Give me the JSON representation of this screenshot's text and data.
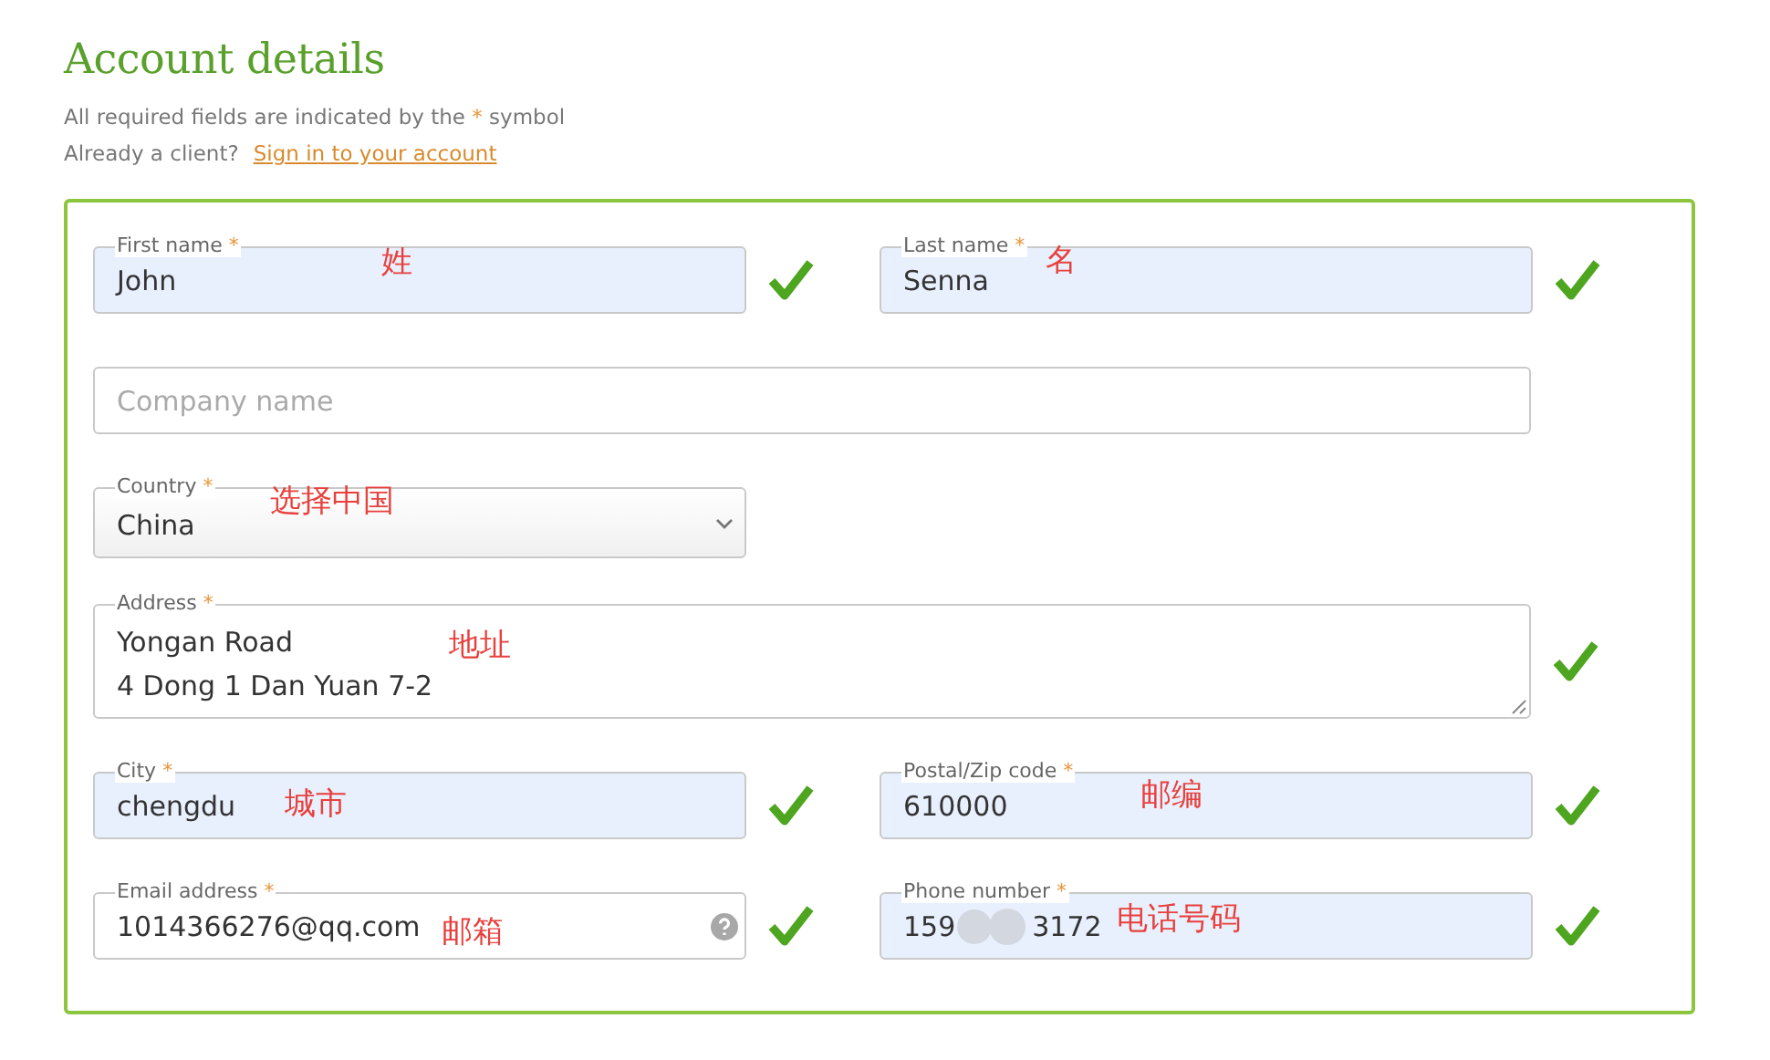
{
  "heading": {
    "title": "Account details",
    "required_note": {
      "before": "All required fields are indicated by the",
      "mark": "*",
      "after": "symbol"
    },
    "signin": {
      "prompt": "Already a client?",
      "link": "Sign in to your account"
    }
  },
  "rows": [
    [
      {
        "kind": "text",
        "label": "First name",
        "required": true,
        "value": "John",
        "autofilled": true,
        "valid": true,
        "annotation": "姓"
      },
      {
        "kind": "text",
        "label": "Last name",
        "required": true,
        "value": "Senna",
        "autofilled": true,
        "valid": true,
        "annotation": "名"
      }
    ],
    [
      {
        "kind": "text",
        "placeholder": "Company name",
        "autofilled": false,
        "valid": false
      }
    ],
    [
      {
        "kind": "select",
        "label": "Country",
        "required": true,
        "value": "China",
        "autofilled": false,
        "valid": false,
        "annotation": "选择中国"
      }
    ],
    [
      {
        "kind": "textarea",
        "label": "Address",
        "required": true,
        "lines": [
          "Yongan Road",
          "4 Dong 1 Dan Yuan 7-2"
        ],
        "autofilled": false,
        "valid": true,
        "annotation": "地址"
      }
    ],
    [
      {
        "kind": "text",
        "label": "City",
        "required": true,
        "value": "chengdu",
        "autofilled": true,
        "valid": true,
        "annotation": "城市"
      },
      {
        "kind": "text",
        "label": "Postal/Zip code",
        "required": true,
        "value": "610000",
        "autofilled": true,
        "valid": true,
        "annotation": "邮编"
      }
    ],
    [
      {
        "kind": "text",
        "label": "Email address",
        "required": true,
        "value": "1014366276@qq.com",
        "autofilled": false,
        "help": true,
        "valid": true,
        "annotation": "邮箱"
      },
      {
        "kind": "redacted",
        "label": "Phone number",
        "required": true,
        "value_start": "159",
        "value_end": "3172",
        "autofilled": true,
        "valid": true,
        "annotation": "电话号码"
      }
    ]
  ]
}
